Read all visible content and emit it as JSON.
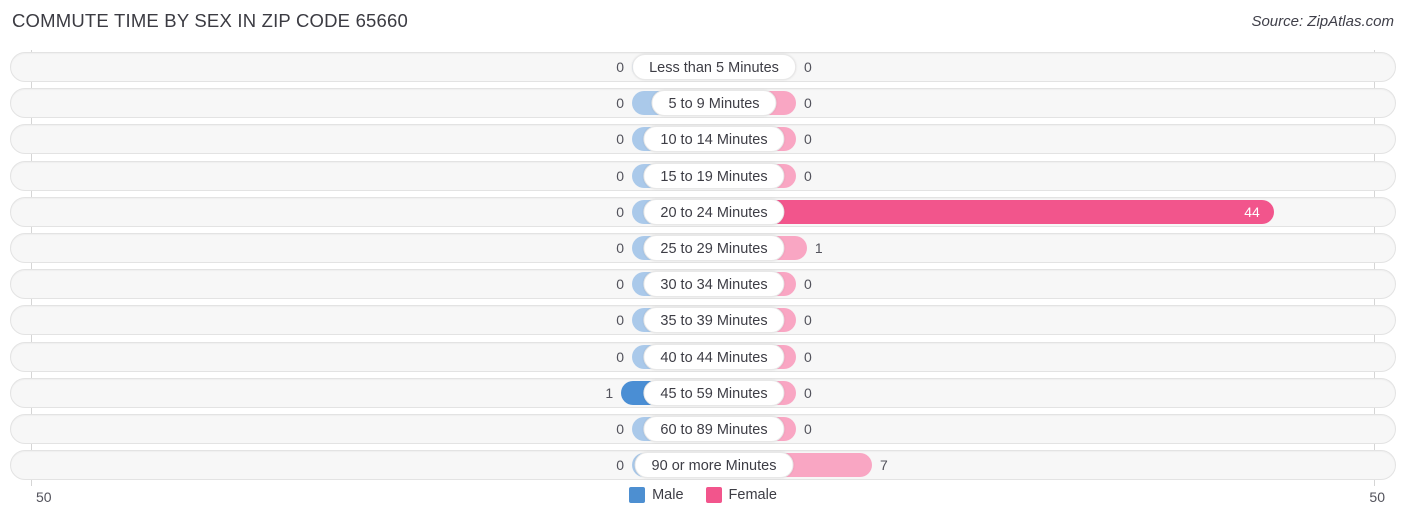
{
  "header": {
    "title": "COMMUTE TIME BY SEX IN ZIP CODE 65660",
    "source": "Source: ZipAtlas.com"
  },
  "axis": {
    "min_label": "50",
    "max_label": "50"
  },
  "legend": {
    "items": [
      {
        "label": "Male",
        "color": "#4d8fd1",
        "icon": "male-color-swatch"
      },
      {
        "label": "Female",
        "color": "#f2558c",
        "icon": "female-color-swatch"
      }
    ]
  },
  "chart_data": {
    "type": "bar",
    "orientation": "horizontal-diverging",
    "title": "COMMUTE TIME BY SEX IN ZIP CODE 65660",
    "xlabel": "",
    "ylabel": "",
    "xlim": [
      -50,
      50
    ],
    "axis_tick_labels": [
      "50",
      "50"
    ],
    "grid": false,
    "legend_position": "bottom-center",
    "categories": [
      "Less than 5 Minutes",
      "5 to 9 Minutes",
      "10 to 14 Minutes",
      "15 to 19 Minutes",
      "20 to 24 Minutes",
      "25 to 29 Minutes",
      "30 to 34 Minutes",
      "35 to 39 Minutes",
      "40 to 44 Minutes",
      "45 to 59 Minutes",
      "60 to 89 Minutes",
      "90 or more Minutes"
    ],
    "series": [
      {
        "name": "Male",
        "color": "#aac9ea",
        "highlight_color": "#4a8ed4",
        "values": [
          0,
          0,
          0,
          0,
          0,
          0,
          0,
          0,
          0,
          1,
          0,
          0
        ],
        "labels": [
          "0",
          "0",
          "0",
          "0",
          "0",
          "0",
          "0",
          "0",
          "0",
          "1",
          "0",
          "0"
        ]
      },
      {
        "name": "Female",
        "color": "#f9a6c3",
        "highlight_color": "#f2558c",
        "values": [
          0,
          0,
          0,
          0,
          44,
          1,
          0,
          0,
          0,
          0,
          0,
          7
        ],
        "labels": [
          "0",
          "0",
          "0",
          "0",
          "44",
          "1",
          "0",
          "0",
          "0",
          "0",
          "0",
          "7"
        ]
      }
    ]
  }
}
